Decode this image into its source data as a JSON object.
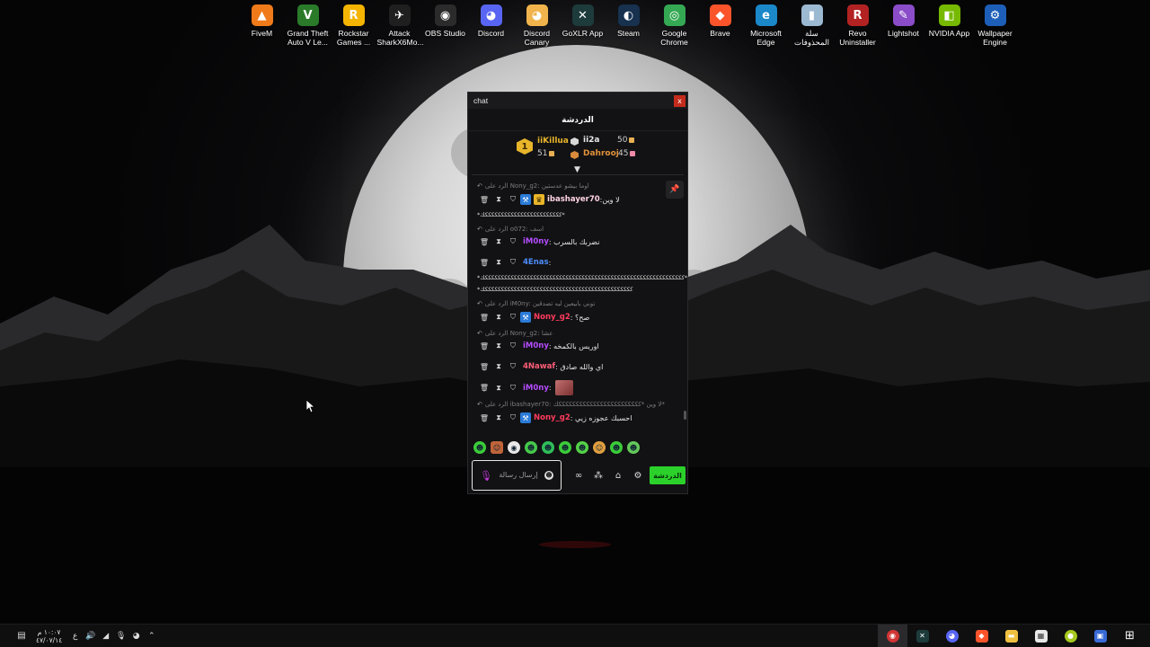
{
  "desktop": {
    "icons": [
      {
        "label": "FiveM",
        "color": "#f07a1a",
        "glyph": "▲"
      },
      {
        "label": "Grand Theft Auto V Le...",
        "color": "#2a7a2a",
        "glyph": "V"
      },
      {
        "label": "Rockstar Games ...",
        "color": "#f5b400",
        "glyph": "R"
      },
      {
        "label": "Attack SharkX6Mo...",
        "color": "#1f1f1f",
        "glyph": "✈"
      },
      {
        "label": "OBS Studio",
        "color": "#2b2b2b",
        "glyph": "◉"
      },
      {
        "label": "Discord",
        "color": "#5865f2",
        "glyph": "◕"
      },
      {
        "label": "Discord Canary",
        "color": "#f1b44c",
        "glyph": "◕"
      },
      {
        "label": "GoXLR App",
        "color": "#1d3b3b",
        "glyph": "✕"
      },
      {
        "label": "Steam",
        "color": "#17314f",
        "glyph": "◐"
      },
      {
        "label": "Google Chrome",
        "color": "#34a853",
        "glyph": "◎"
      },
      {
        "label": "Brave",
        "color": "#fb542b",
        "glyph": "◆"
      },
      {
        "label": "Microsoft Edge",
        "color": "#1a88c9",
        "glyph": "e"
      },
      {
        "label": "سلة المحذوفات",
        "color": "#9cb9d2",
        "glyph": "▮"
      },
      {
        "label": "Revo Uninstaller",
        "color": "#b32222",
        "glyph": "R"
      },
      {
        "label": "Lightshot",
        "color": "#8a4cc8",
        "glyph": "✎"
      },
      {
        "label": "NVIDIA App",
        "color": "#76b900",
        "glyph": "◧"
      },
      {
        "label": "Wallpaper Engine",
        "color": "#1d5fb8",
        "glyph": "⚙"
      }
    ]
  },
  "chat": {
    "window_title": "chat",
    "close_label": "x",
    "header": "الدردشة",
    "leaderboard": {
      "rank": "1",
      "first_name": "iiKillua",
      "first_score": "51",
      "second_name": "ii2a",
      "second_score": "50",
      "third_name": "Dahrooj",
      "third_score": "45"
    },
    "messages": {
      "m1_reply": "الرد على Nony_g2: اوما بيشو عدستين",
      "m1_user": "ibashayer70",
      "m1_text": ":لا وين",
      "m1_extra": "*ككككككككككككككككككككككككك*",
      "m2_reply": "الرد على o072: اسف",
      "m2_user": "iM0ny",
      "m2_text": ": نضربك بالسرب",
      "m3_user": "4Enas",
      "m3_text": ":",
      "m3_line1": "*ككككككككككككككككككككككككككككككككككككككككككككككككككككككككككككككك*",
      "m3_line2": "*ككككككككككككككككككككككككككككككككككككككككككككككك",
      "m4_reply": "الرد على iM0ny: توني بابيعين ليه تصدقين",
      "m4_user": "Nony_g2",
      "m4_text": ": صح؟",
      "m5_reply": "الرد على Nony_g2: عشا",
      "m5_user": "iM0ny",
      "m5_text": ": اوريس بالكمخه",
      "m6_user": "4Nawaf",
      "m6_text": ": اي والله صادق",
      "m7_user": "iM0ny",
      "m7_text": ":",
      "m8_reply": "الرد على ibashayer70: لا وين *ككككككككككككككككككككككككك*",
      "m8_user": "Nony_g2",
      "m8_text": ": احسبك عجوزه زيي"
    },
    "input_placeholder": "إرسال رسالة",
    "chat_tab_label": "الدردشة"
  },
  "taskbar": {
    "time": "١٠:٠٧ م",
    "date": "٤٧/٠٧/١٤",
    "lang": "ع"
  },
  "colors": {
    "green": "#2bd12a",
    "purple_user": "#b54cff",
    "pink_user": "#ff6b9a",
    "blue_user": "#4d8dff",
    "red_user": "#ff3b5c",
    "gold": "#e8b52a"
  }
}
